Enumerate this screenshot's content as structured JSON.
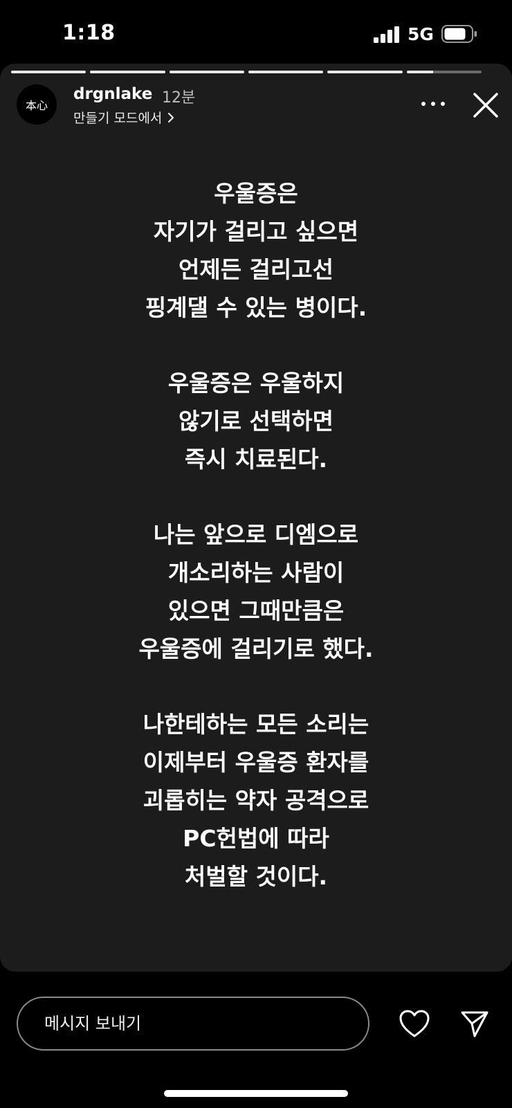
{
  "status_bar": {
    "time": "1:18",
    "network": "5G",
    "signal_icon": "signal-bars-icon",
    "battery_icon": "battery-icon"
  },
  "story": {
    "progress": [
      1,
      1,
      1,
      1,
      1,
      0.35
    ],
    "account": {
      "avatar_text": "本心",
      "username": "drgnlake",
      "time_ago": "12분",
      "mode_link": "만들기 모드에서"
    },
    "icons": {
      "more": "more-dots-icon",
      "close": "close-icon",
      "chevron": "chevron-right-icon"
    },
    "stanzas": [
      [
        "우울증은",
        "자기가 걸리고 싶으면",
        "언제든 걸리고선",
        "핑계댈 수 있는 병이다."
      ],
      [
        "우울증은 우울하지",
        "않기로 선택하면",
        "즉시 치료된다."
      ],
      [
        "나는 앞으로 디엠으로",
        "개소리하는 사람이",
        "있으면 그때만큼은",
        "우울증에 걸리기로 했다."
      ],
      [
        "나한테하는 모든 소리는",
        "이제부터 우울증 환자를",
        "괴롭히는 약자 공격으로",
        "PC헌법에 따라",
        "처벌할 것이다."
      ]
    ]
  },
  "bottom_bar": {
    "message_placeholder": "메시지 보내기",
    "heart_icon": "heart-icon",
    "send_icon": "send-icon"
  },
  "colors": {
    "background": "#000000",
    "story_background": "#1c1c1c",
    "text": "#ffffff",
    "muted_text": "#bdbdbd"
  }
}
